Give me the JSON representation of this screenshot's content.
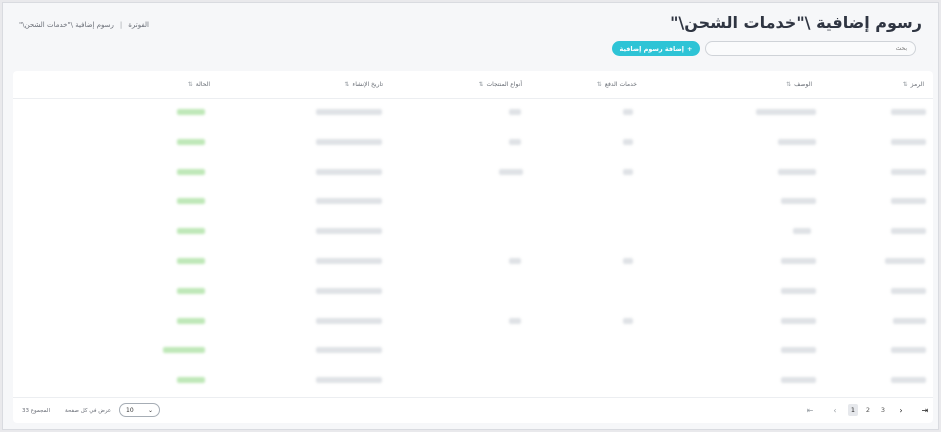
{
  "page": {
    "title": "رسوم إضافية \\\"خدمات الشحن\\\"",
    "breadcrumb": [
      "الفوترة",
      "رسوم إضافية \\\"خدمات الشحن\\\""
    ]
  },
  "toolbar": {
    "search_placeholder": "بحث",
    "add_label": "إضافة رسوم إضافية",
    "add_icon": "plus-icon"
  },
  "table": {
    "columns": [
      "الرمز",
      "الوصف",
      "خدمات الدفع",
      "أنواع المنتجات",
      "تاريخ الإنشاء",
      "الحالة"
    ],
    "sort_icon": "sort-icon"
  },
  "footer": {
    "total_label": "المجموع 33",
    "per_page_label": "عرض في كل صفحة",
    "per_page_value": "10",
    "pages": [
      "1",
      "2",
      "3"
    ],
    "current_page": "1"
  },
  "colors": {
    "accent": "#2ec4d6",
    "status_active": "#bfe8b8",
    "blurred_cell": "#dfe2e6"
  }
}
